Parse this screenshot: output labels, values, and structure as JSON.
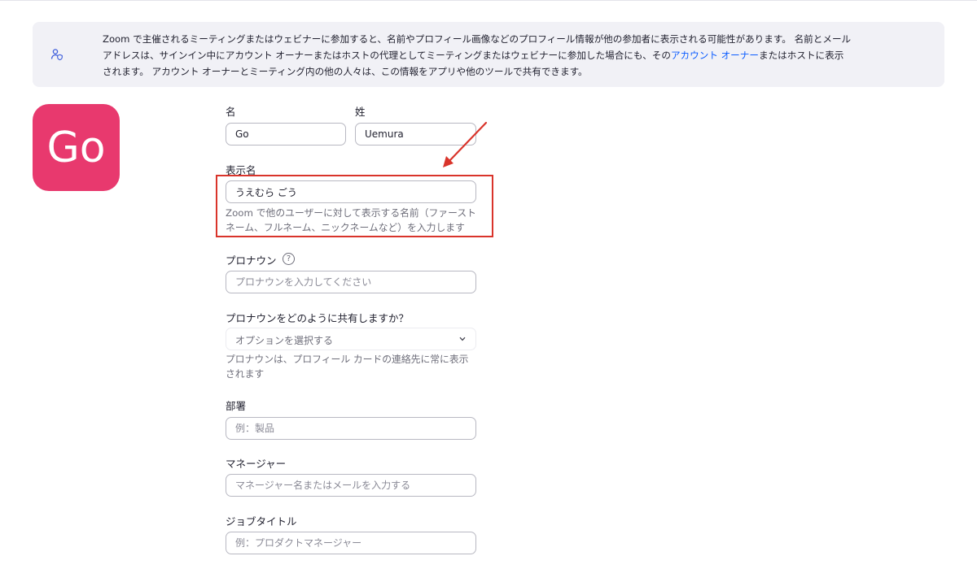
{
  "notice": {
    "icon": "user-shield-icon",
    "text_part1": "Zoom で主催されるミーティングまたはウェビナーに参加すると、名前やプロフィール画像などのプロフィール情報が他の参加者に表示される可能性があります。 名前とメールアドレスは、サインイン中にアカウント オーナーまたはホストの代理としてミーティングまたはウェビナーに参加した場合にも、その",
    "link_text": "アカウント オーナー",
    "text_part2": "またはホストに表示されます。 アカウント オーナーとミーティング内の他の人々は、この情報をアプリや他のツールで共有できます。"
  },
  "avatar": {
    "initials": "Go",
    "color": "#e8396e"
  },
  "form": {
    "first_name": {
      "label": "名",
      "value": "Go"
    },
    "last_name": {
      "label": "姓",
      "value": "Uemura"
    },
    "display_name": {
      "label": "表示名",
      "value": "うえむら ごう",
      "helper_line1": "Zoom で他のユーザーに対して表示する名前（ファースト",
      "helper_line2": "ネーム、フルネーム、ニックネームなど）を入力します"
    },
    "pronouns": {
      "label": "プロナウン",
      "help_icon": "question-circle-icon",
      "help_glyph": "?",
      "placeholder": "プロナウンを入力してください"
    },
    "pronoun_sharing": {
      "label": "プロナウンをどのように共有しますか？",
      "selected": "オプションを選択する",
      "helper_line1": "プロナウンは、プロフィール カードの連絡先に常に表示",
      "helper_line2": "されます"
    },
    "department": {
      "label": "部署",
      "placeholder": "例：製品"
    },
    "manager": {
      "label": "マネージャー",
      "placeholder": "マネージャー名またはメールを入力する"
    },
    "job_title": {
      "label": "ジョブタイトル",
      "placeholder": "例：プロダクトマネージャー"
    }
  },
  "annotation": {
    "color": "#d9342b"
  }
}
